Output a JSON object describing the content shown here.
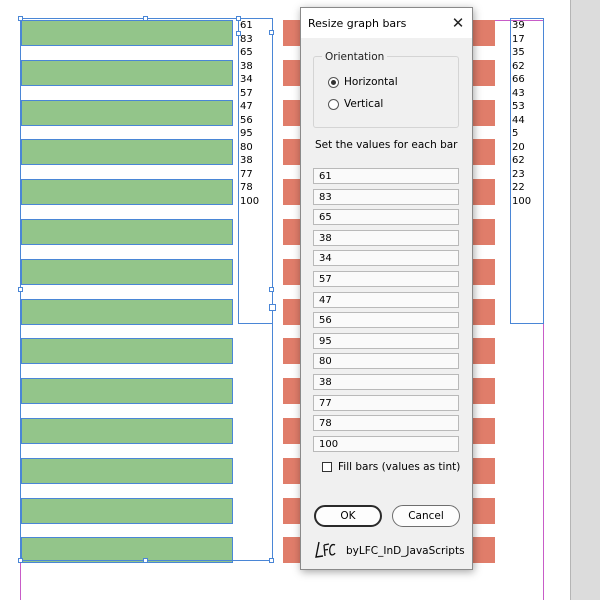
{
  "dialog": {
    "title": "Resize graph bars",
    "orientation_label": "Orientation",
    "orientation_options": [
      "Horizontal",
      "Vertical"
    ],
    "selected_orientation": "Horizontal",
    "values_label": "Set the values for each bar",
    "values": [
      "61",
      "83",
      "65",
      "38",
      "34",
      "57",
      "47",
      "56",
      "95",
      "80",
      "38",
      "77",
      "78",
      "100"
    ],
    "fill_bars_label": "Fill bars (values as tint)",
    "fill_bars_checked": false,
    "ok_label": "OK",
    "cancel_label": "Cancel",
    "footer": "byLFC_InD_JavaScripts",
    "logo_text": "LFC"
  },
  "graph_left": {
    "labels": [
      "61",
      "83",
      "65",
      "38",
      "34",
      "57",
      "47",
      "56",
      "95",
      "80",
      "38",
      "77",
      "78",
      "100"
    ],
    "bar_color": "#93c58a"
  },
  "graph_right": {
    "labels": [
      "39",
      "17",
      "35",
      "62",
      "66",
      "43",
      "53",
      "44",
      "5",
      "20",
      "62",
      "23",
      "22",
      "100"
    ],
    "bar_color": "#e07d6a"
  },
  "colors": {
    "selection": "#4a86d6",
    "page_guide": "#c85cc8"
  }
}
